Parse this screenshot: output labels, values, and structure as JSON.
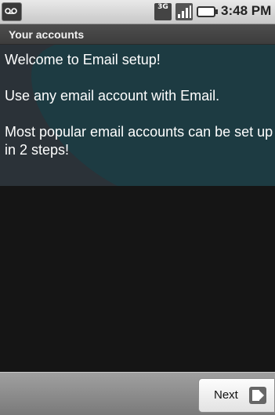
{
  "status_bar": {
    "network_label": "3G",
    "time": "3:48 PM",
    "icons": [
      "voicemail-icon",
      "network-3g-icon",
      "signal-icon",
      "battery-icon"
    ]
  },
  "title_bar": {
    "title": "Your accounts"
  },
  "content": {
    "welcome": "Welcome to Email setup!",
    "use_any": "Use any email account with Email.",
    "popular": "Most popular email accounts can be set up in 2 steps!"
  },
  "bottom_bar": {
    "next_label": "Next"
  },
  "colors": {
    "content_bg": "#2b3238",
    "teal_shape": "#1d3b42",
    "text": "#ffffff"
  }
}
